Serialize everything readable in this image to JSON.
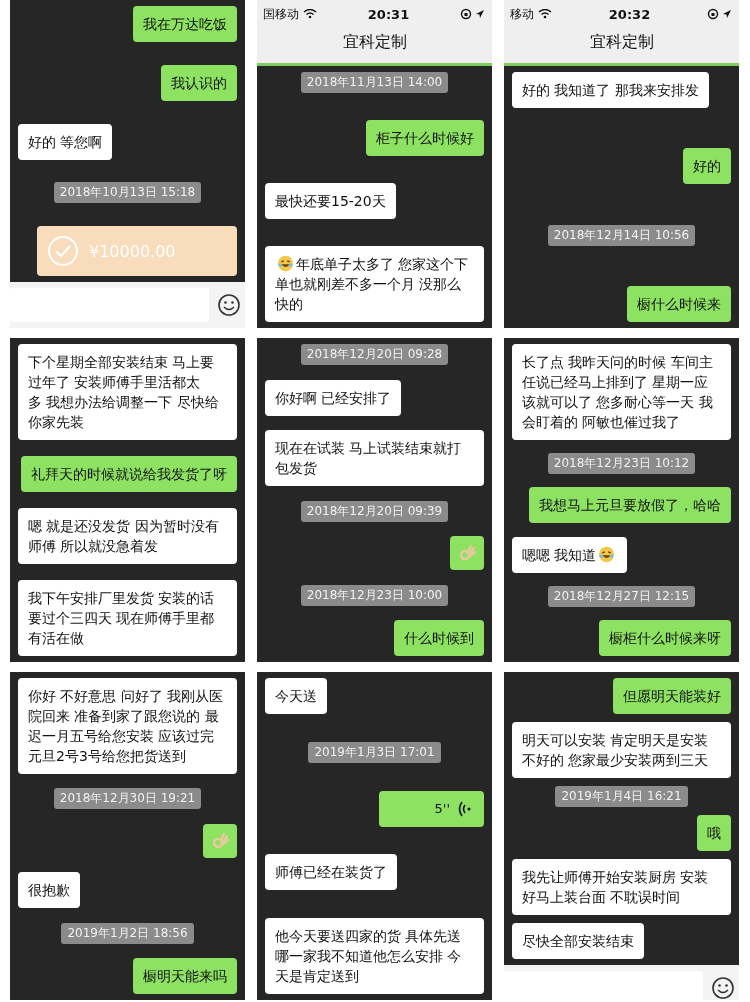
{
  "rows": [
    {
      "panels": [
        {
          "messages": [
            {
              "kind": "out",
              "text": "我在万达吃饭"
            },
            {
              "kind": "out",
              "text": "我认识的"
            },
            {
              "kind": "in",
              "text": "好的 等您啊"
            },
            {
              "kind": "time",
              "text": "2018年10月13日 15:18"
            },
            {
              "kind": "transfer",
              "text": "¥10000.00"
            }
          ],
          "input_bar": true
        },
        {
          "status": {
            "carrier": "国移动",
            "time": "20:31"
          },
          "title": "宜科定制",
          "messages": [
            {
              "kind": "time",
              "text": "2018年11月13日 14:00"
            },
            {
              "kind": "out",
              "text": "柜子什么时候好"
            },
            {
              "kind": "in",
              "text": "最快还要15-20天"
            },
            {
              "kind": "in",
              "text": "年底单子太多了 您家这个下单也就刚差不多一个月 没那么快的",
              "emoji_before": true
            }
          ],
          "input_bar": false
        },
        {
          "status": {
            "carrier": "移动",
            "time": "20:32"
          },
          "title": "宜科定制",
          "messages": [
            {
              "kind": "in",
              "text": "好的 我知道了 那我来安排发"
            },
            {
              "kind": "out",
              "text": "好的"
            },
            {
              "kind": "time",
              "text": "2018年12月14日 10:56"
            },
            {
              "kind": "out",
              "text": "橱什么时候来"
            }
          ],
          "input_bar": false
        }
      ]
    },
    {
      "panels": [
        {
          "messages": [
            {
              "kind": "in",
              "text": "下个星期全部安装结束 马上要过年了 安装师傅手里活都太多 我想办法给调整一下 尽快给你家先装"
            },
            {
              "kind": "out",
              "text": "礼拜天的时候就说给我发货了呀"
            },
            {
              "kind": "in",
              "text": "嗯 就是还没发货 因为暂时没有师傅 所以就没急着发"
            },
            {
              "kind": "in",
              "text": "我下午安排厂里发货 安装的话要过个三四天 现在师傅手里都有活在做"
            }
          ],
          "input_bar": false
        },
        {
          "messages": [
            {
              "kind": "time",
              "text": "2018年12月20日 09:28"
            },
            {
              "kind": "in",
              "text": "你好啊 已经安排了"
            },
            {
              "kind": "in",
              "text": "现在在试装 马上试装结束就打包发货"
            },
            {
              "kind": "time",
              "text": "2018年12月20日 09:39"
            },
            {
              "kind": "sticker"
            },
            {
              "kind": "time",
              "text": "2018年12月23日 10:00"
            },
            {
              "kind": "out",
              "text": "什么时候到"
            }
          ],
          "input_bar": false
        },
        {
          "messages": [
            {
              "kind": "in",
              "text": "长了点 我昨天问的时候 车间主任说已经马上排到了 星期一应该就可以了 您多耐心等一天 我会盯着的 阿敏也催过我了"
            },
            {
              "kind": "time",
              "text": "2018年12月23日 10:12"
            },
            {
              "kind": "out",
              "text": "我想马上元旦要放假了，哈哈"
            },
            {
              "kind": "in",
              "text": "嗯嗯 我知道",
              "emoji_after": true
            },
            {
              "kind": "time",
              "text": "2018年12月27日 12:15"
            },
            {
              "kind": "out",
              "text": "橱柜什么时候来呀"
            }
          ],
          "input_bar": false
        }
      ]
    },
    {
      "panels": [
        {
          "messages": [
            {
              "kind": "in",
              "text": "你好 不好意思 问好了 我刚从医院回来 准备到家了跟您说的 最迟一月五号给您安装 应该过完元旦2号3号给您把货送到"
            },
            {
              "kind": "time",
              "text": "2018年12月30日 19:21"
            },
            {
              "kind": "sticker"
            },
            {
              "kind": "in",
              "text": "很抱歉"
            },
            {
              "kind": "time",
              "text": "2019年1月2日 18:56"
            },
            {
              "kind": "out",
              "text": "橱明天能来吗"
            }
          ],
          "input_bar": false
        },
        {
          "messages": [
            {
              "kind": "in",
              "text": "今天送"
            },
            {
              "kind": "time",
              "text": "2019年1月3日 17:01"
            },
            {
              "kind": "voice",
              "text": "5''"
            },
            {
              "kind": "in",
              "text": "师傅已经在装货了"
            },
            {
              "kind": "in",
              "text": "他今天要送四家的货 具体先送哪一家我不知道他怎么安排 今天是肯定送到"
            }
          ],
          "input_bar": false
        },
        {
          "messages": [
            {
              "kind": "out",
              "text": "但愿明天能装好"
            },
            {
              "kind": "in",
              "text": "明天可以安装 肯定明天是安装不好的 您家最少安装两到三天"
            },
            {
              "kind": "time",
              "text": "2019年1月4日 16:21"
            },
            {
              "kind": "out",
              "text": "哦"
            },
            {
              "kind": "in",
              "text": "我先让师傅开始安装厨房 安装好马上装台面 不耽误时间"
            },
            {
              "kind": "in",
              "text": "尽快全部安装结束"
            }
          ],
          "input_bar": true
        }
      ]
    }
  ]
}
